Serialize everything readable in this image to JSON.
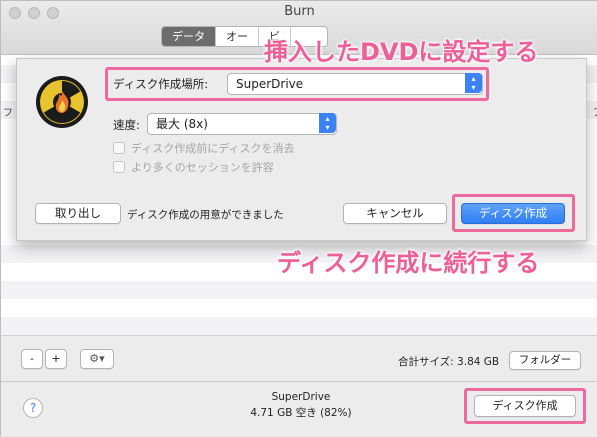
{
  "window": {
    "title": "Burn",
    "tabs": [
      {
        "label": "データ",
        "active": true
      },
      {
        "label": "オー",
        "active": false
      },
      {
        "label": "ビ",
        "active": false
      },
      {
        "label": "",
        "active": false
      }
    ]
  },
  "list": {
    "left_stub": "フ",
    "right_stub": "ア"
  },
  "sheet": {
    "destination_label": "ディスク作成場所:",
    "destination_value": "SuperDrive",
    "speed_label": "速度:",
    "speed_value": "最大 (8x)",
    "erase_checkbox": "ディスク作成前にディスクを消去",
    "sessions_checkbox": "より多くのセッションを許容",
    "eject_button": "取り出し",
    "status_text": "ディスク作成の用意ができました",
    "cancel_button": "キャンセル",
    "burn_button": "ディスク作成"
  },
  "annotations": {
    "top": "挿入したDVDに設定する",
    "bottom": "ディスク作成に続行する"
  },
  "toolbar": {
    "minus": "-",
    "plus": "+",
    "gear": "⚙▾",
    "total_size": "合計サイズ: 3.84 GB",
    "folder_button": "フォルダー"
  },
  "status": {
    "help": "?",
    "drive_name": "SuperDrive",
    "free_space": "4.71 GB 空き (82%)",
    "burn_button": "ディスク作成"
  },
  "colors": {
    "annotation_pink": "#ec5f97",
    "primary_blue": "#2e7ff2"
  },
  "icons": [
    "burn-radiation-flame-icon",
    "chevron-up-down-icon",
    "gear-icon",
    "help-icon"
  ]
}
